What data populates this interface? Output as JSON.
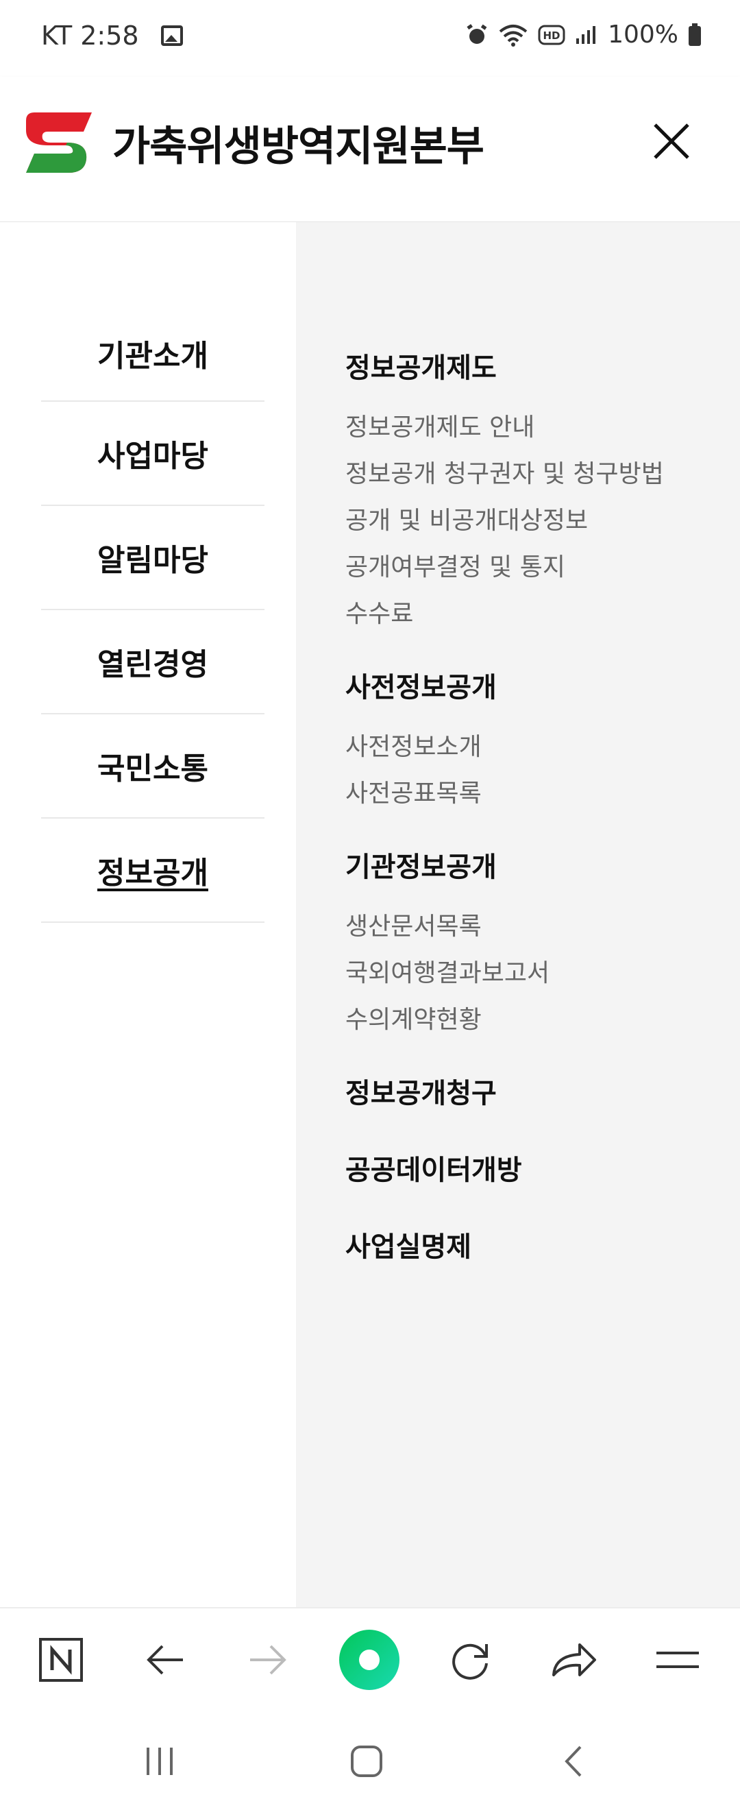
{
  "status_bar": {
    "carrier_time": "KT 2:58",
    "battery": "100%",
    "icons": [
      "gallery-icon",
      "alarm-icon",
      "wifi-icon",
      "hd-icon",
      "signal-icon",
      "battery-icon"
    ]
  },
  "header": {
    "site_title": "가축위생방역지원본부",
    "logo_colors": {
      "red": "#e0202a",
      "green": "#2e9a3c"
    }
  },
  "main_menu": {
    "items": [
      {
        "label": "기관소개",
        "active": false
      },
      {
        "label": "사업마당",
        "active": false
      },
      {
        "label": "알림마당",
        "active": false
      },
      {
        "label": "열린경영",
        "active": false
      },
      {
        "label": "국민소통",
        "active": false
      },
      {
        "label": "정보공개",
        "active": true
      }
    ]
  },
  "sub_menu": {
    "sections": [
      {
        "title": "정보공개제도",
        "items": [
          "정보공개제도 안내",
          "정보공개 청구권자 및 청구방법",
          "공개 및 비공개대상정보",
          "공개여부결정 및 통지",
          "수수료"
        ]
      },
      {
        "title": "사전정보공개",
        "items": [
          "사전정보소개",
          "사전공표목록"
        ]
      },
      {
        "title": "기관정보공개",
        "items": [
          "생산문서목록",
          "국외여행결과보고서",
          "수의계약현황"
        ]
      },
      {
        "title": "정보공개청구",
        "items": []
      },
      {
        "title": "공공데이터개방",
        "items": []
      },
      {
        "title": "사업실명제",
        "items": []
      }
    ]
  },
  "browser_toolbar": {
    "items": [
      "naver-n-icon",
      "back-arrow-icon",
      "forward-arrow-icon",
      "green-dot-icon",
      "refresh-icon",
      "share-icon",
      "menu-icon"
    ],
    "accent": "#03c75a"
  },
  "nav_bar": {
    "items": [
      "recent-apps-icon",
      "home-icon",
      "back-icon"
    ]
  }
}
